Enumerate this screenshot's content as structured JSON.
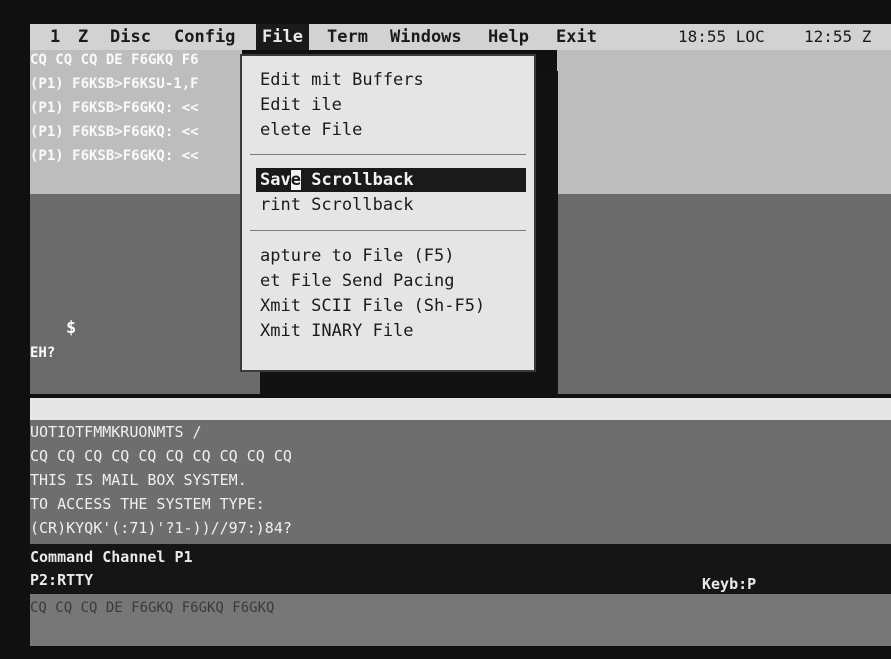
{
  "menubar": {
    "items": [
      "1",
      "Z",
      "Disc",
      "Config",
      "File",
      "Term",
      "Windows",
      "Help",
      "Exit"
    ],
    "active": "File",
    "clock_loc": "18:55 LOC",
    "clock_z": "12:55 Z"
  },
  "top_terminal": {
    "lines": [
      "CQ CQ CQ DE F6GKQ F6",
      "(P1) F6KSB>F6KSU-1,F",
      "(P1) F6KSB>F6GKQ: <<",
      "(P1) F6KSB>F6GKQ: <<",
      "(P1) F6KSB>F6GKQ: <<"
    ],
    "prompt_symbol": "$",
    "prompt_text": "EH?"
  },
  "file_menu": {
    "group1": [
      {
        "text": "Edit  mit Buffers"
      },
      {
        "text": "Edit  ile"
      },
      {
        "text": " elete File"
      }
    ],
    "save_scrollback": {
      "prefix": "Sav",
      "hotkey": "e",
      "suffix": " Scrollback"
    },
    "group2": [
      {
        "text": " rint Scrollback"
      }
    ],
    "group3": [
      {
        "text": " apture to File (F5)"
      },
      {
        "text": " et File Send Pacing"
      },
      {
        "text": "Xmit  SCII File (Sh-F5)"
      },
      {
        "text": "Xmit  INARY File"
      }
    ]
  },
  "bottom_terminal": {
    "lines": [
      "UOTIOTFMMKRUONMTS /",
      "CQ CQ CQ CQ CQ CQ CQ CQ CQ CQ",
      "THIS IS  MAIL BOX SYSTEM.",
      "TO ACCESS THE SYSTEM TYPE:",
      "(CR)KYQK'(:71)'?1-))//97:)84?"
    ]
  },
  "status": {
    "channel": "Command Channel P1",
    "mode": "P2:RTTY",
    "keyboard": "Keyb:P"
  },
  "input_line": {
    "text": "CQ CQ CQ DE F6GKQ F6GKQ F6GKQ"
  }
}
